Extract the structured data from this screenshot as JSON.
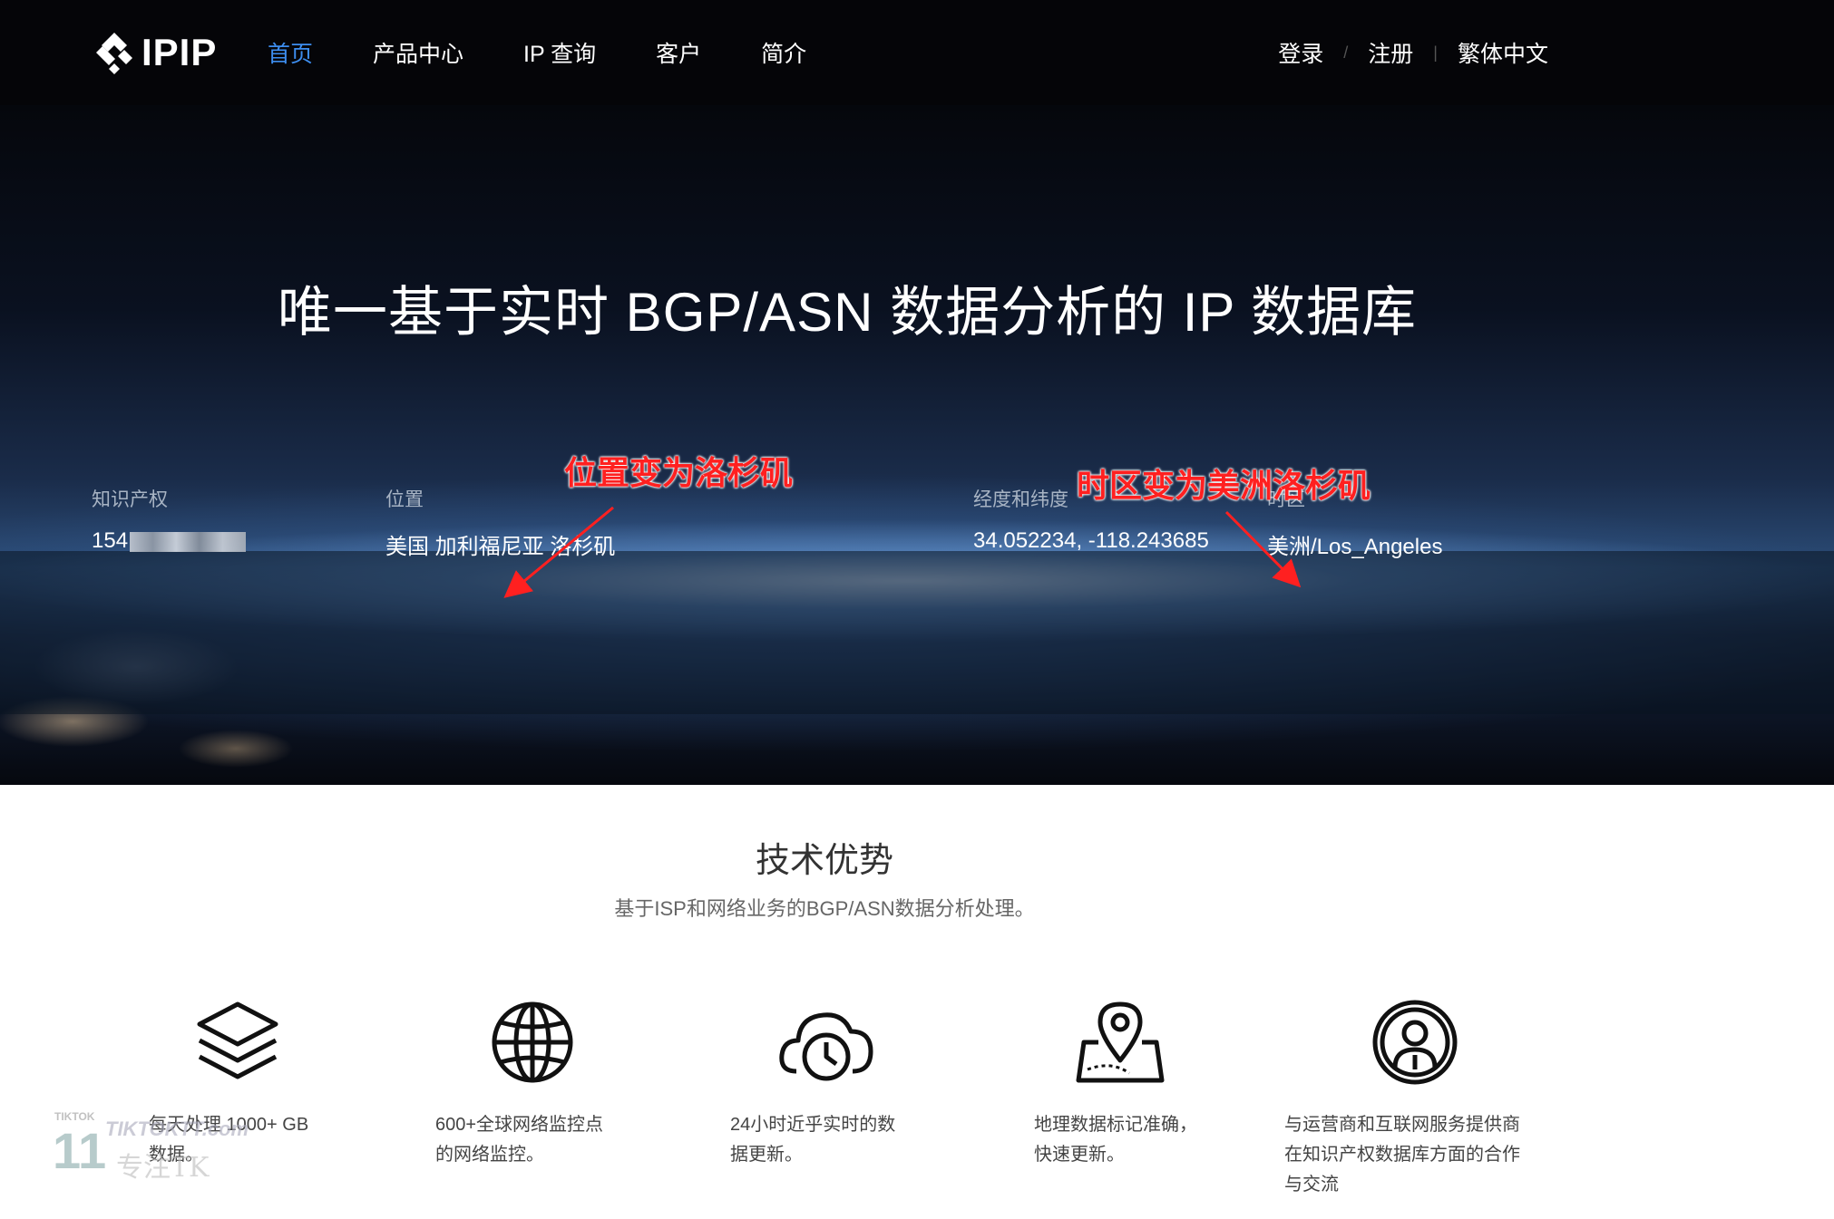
{
  "nav": {
    "logo_text": "IPIP",
    "links": [
      "首页",
      "产品中心",
      "IP 查询",
      "客户",
      "简介"
    ],
    "right_links": [
      "登录",
      "注册",
      "繁体中文"
    ],
    "separators": [
      "/",
      "|"
    ]
  },
  "hero": {
    "title": "唯一基于实时 BGP/ASN 数据分析的 IP 数据库",
    "info": [
      {
        "label": "知识产权",
        "value": "154"
      },
      {
        "label": "位置",
        "value": "美国 加利福尼亚 洛杉矶"
      },
      {
        "label": "经度和纬度",
        "value": "34.052234, -118.243685"
      },
      {
        "label": "时区",
        "value": "美洲/Los_Angeles"
      }
    ],
    "annotations": [
      "位置变为洛杉矶",
      "时区变为美洲洛杉矶"
    ]
  },
  "advantages": {
    "title": "技术优势",
    "subtitle": "基于ISP和网络业务的BGP/ASN数据分析处理。",
    "features": [
      {
        "icon": "layers-icon",
        "text": "每天处理 1000+ GB\n数据。"
      },
      {
        "icon": "globe-icon",
        "text": "600+全球网络监控点\n的网络监控。"
      },
      {
        "icon": "cloud-clock-icon",
        "text": "24小时近乎实时的数\n据更新。"
      },
      {
        "icon": "map-pin-icon",
        "text": "地理数据标记准确，\n快速更新。"
      },
      {
        "icon": "user-circle-icon",
        "text": "与运营商和互联网服务提供商\n在知识产权数据库方面的合作\n与交流"
      }
    ]
  },
  "watermark": {
    "small": "TIKTOK",
    "big": "11",
    "site": "TIKTOKTT.com",
    "cn": "专注TK"
  },
  "colors": {
    "accent": "#3d8ef0",
    "annotation": "#ff2020",
    "nav_bg": "#050508"
  }
}
